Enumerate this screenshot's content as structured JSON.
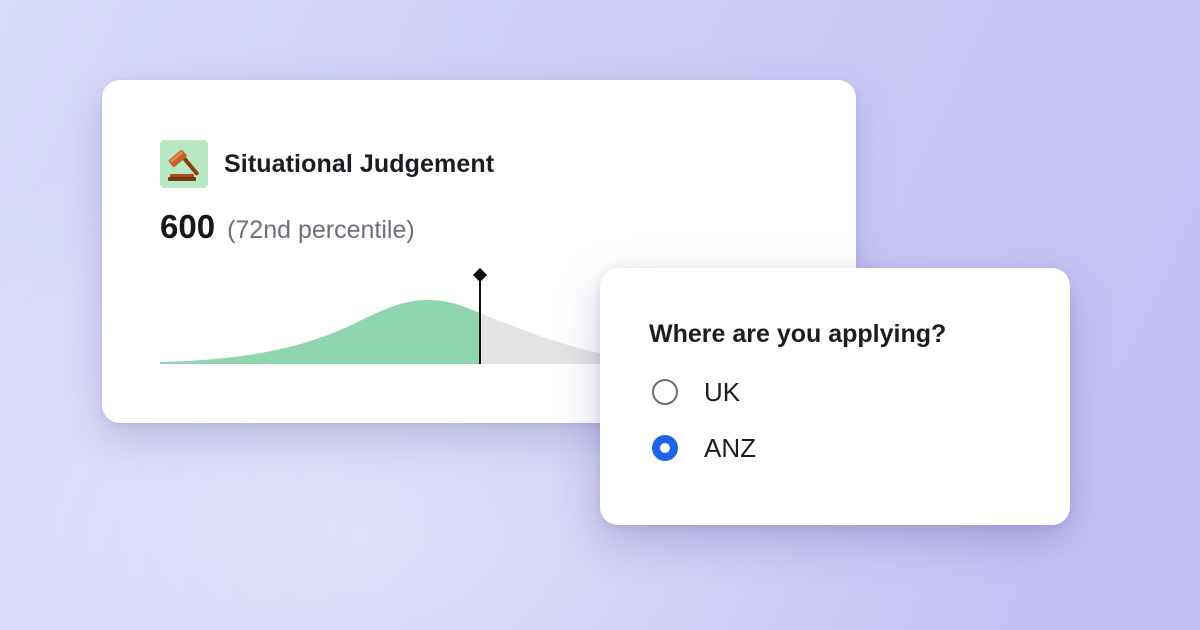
{
  "score_card": {
    "icon": "gavel-icon",
    "title": "Situational Judgement",
    "score": "600",
    "percentile": "(72nd percentile)",
    "colors": {
      "filled": "#8fd6b0",
      "remaining": "#e4e4e6",
      "marker": "#111111"
    }
  },
  "question_card": {
    "question": "Where are you applying?",
    "options": [
      {
        "label": "UK",
        "selected": false
      },
      {
        "label": "ANZ",
        "selected": true
      }
    ],
    "accent_color": "#1f63e6"
  }
}
